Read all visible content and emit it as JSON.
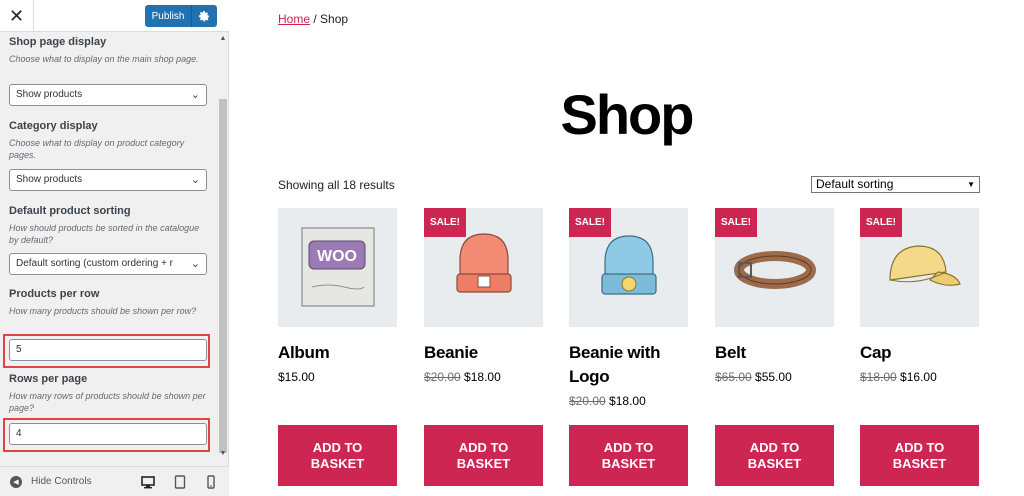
{
  "customizer": {
    "close_icon": "close-icon",
    "publish_label": "Publish",
    "sections": {
      "shop_page_display": {
        "title": "Shop page display",
        "description": "Choose what to display on the main shop page.",
        "value": "Show products"
      },
      "category_display": {
        "title": "Category display",
        "description": "Choose what to display on product category pages.",
        "value": "Show products"
      },
      "default_sorting": {
        "title": "Default product sorting",
        "description": "How should products be sorted in the catalogue by default?",
        "value": "Default sorting (custom ordering + r"
      },
      "products_per_row": {
        "title": "Products per row",
        "description": "How many products should be shown per row?",
        "value": "5"
      },
      "rows_per_page": {
        "title": "Rows per page",
        "description": "How many rows of products should be shown per page?",
        "value": "4"
      }
    },
    "footer": {
      "hide_controls_label": "Hide Controls"
    }
  },
  "preview": {
    "breadcrumb": {
      "home": "Home",
      "separator": " / ",
      "current": "Shop"
    },
    "title": "Shop",
    "result_count": "Showing all 18 results",
    "sorting_value": "Default sorting",
    "accent_color": "#cd2653",
    "products": [
      {
        "name": "Album",
        "price": "$15.00",
        "old_price": "",
        "sale": false,
        "image": "woo-album-icon"
      },
      {
        "name": "Beanie",
        "price": "$18.00",
        "old_price": "$20.00",
        "sale": true,
        "image": "beanie-icon"
      },
      {
        "name": "Beanie with Logo",
        "price": "$18.00",
        "old_price": "$20.00",
        "sale": true,
        "image": "beanie-logo-icon"
      },
      {
        "name": "Belt",
        "price": "$55.00",
        "old_price": "$65.00",
        "sale": true,
        "image": "belt-icon"
      },
      {
        "name": "Cap",
        "price": "$16.00",
        "old_price": "$18.00",
        "sale": true,
        "image": "cap-icon"
      }
    ],
    "sale_label": "SALE!",
    "add_to_basket_label": "ADD TO BASKET"
  }
}
